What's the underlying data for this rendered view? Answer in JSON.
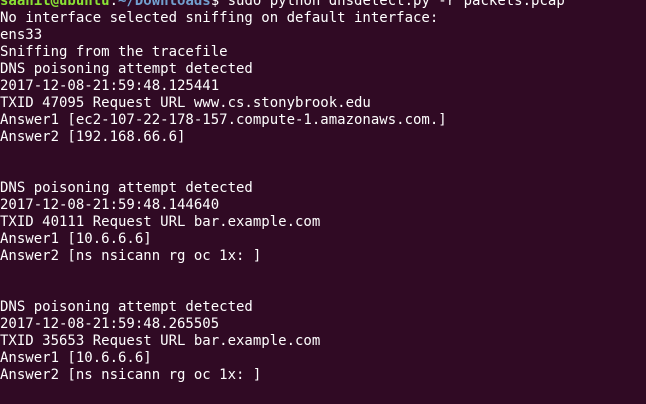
{
  "prompt": {
    "user_host": "saahil@ubuntu",
    "separator": ":",
    "path": "~/Downloads",
    "symbol": "$ ",
    "command": "sudo python dnsdetect.py -r packets.pcap"
  },
  "output_lines": [
    "No interface selected sniffing on default interface:",
    "ens33",
    "Sniffing from the tracefile",
    "DNS poisoning attempt detected",
    "2017-12-08-21:59:48.125441",
    "TXID 47095 Request URL www.cs.stonybrook.edu",
    "Answer1 [ec2-107-22-178-157.compute-1.amazonaws.com.]",
    "Answer2 [192.168.66.6]",
    "",
    "",
    "DNS poisoning attempt detected",
    "2017-12-08-21:59:48.144640",
    "TXID 40111 Request URL bar.example.com",
    "Answer1 [10.6.6.6]",
    "Answer2 [ns nsicann rg oc 1x: ]",
    "",
    "",
    "DNS poisoning attempt detected",
    "2017-12-08-21:59:48.265505",
    "TXID 35653 Request URL bar.example.com",
    "Answer1 [10.6.6.6]",
    "Answer2 [ns nsicann rg oc 1x: ]"
  ],
  "colors": {
    "background": "#300a24",
    "text": "#ffffff",
    "prompt_user": "#8ae234",
    "prompt_path": "#729fcf"
  }
}
